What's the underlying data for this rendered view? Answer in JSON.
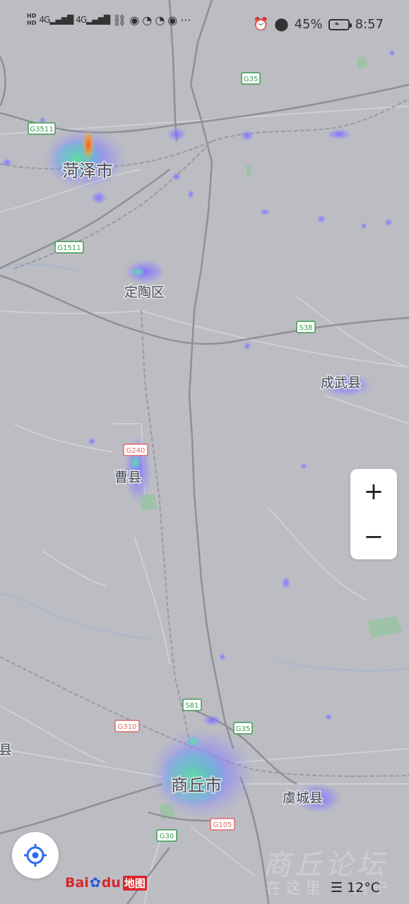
{
  "status_bar": {
    "hd_top": "HD",
    "hd_bottom": "HD",
    "net1": "4G",
    "net2": "4G",
    "battery": "45%",
    "time": "8:57",
    "more": "···"
  },
  "cities": [
    {
      "label": "菏泽市"
    },
    {
      "label": "定陶区"
    },
    {
      "label": "成武县"
    },
    {
      "label": "曹县"
    },
    {
      "label": "商丘市"
    },
    {
      "label": "虞城县"
    },
    {
      "label": "县"
    }
  ],
  "road_shields": [
    {
      "label": "G35",
      "color": "#3c9a4f"
    },
    {
      "label": "G3511",
      "color": "#3c9a4f"
    },
    {
      "label": "G1511",
      "color": "#3c9a4f"
    },
    {
      "label": "S38",
      "color": "#3c9a4f"
    },
    {
      "label": "G240",
      "color": "#e06a6a"
    },
    {
      "label": "S81",
      "color": "#3c9a4f"
    },
    {
      "label": "G35",
      "color": "#3c9a4f"
    },
    {
      "label": "G310",
      "color": "#e06a6a"
    },
    {
      "label": "G105",
      "color": "#e06a6a"
    },
    {
      "label": "G30",
      "color": "#3c9a4f"
    }
  ],
  "controls": {
    "zoom_in": "+",
    "zoom_out": "−"
  },
  "logo": {
    "bai": "Bai",
    "du": "du",
    "cn": "地图"
  },
  "weather": {
    "temp": "12°C"
  },
  "watermark": {
    "text": "商丘论坛",
    "sub": "在这里 · 商宁"
  },
  "colors": {
    "map_bg": "#bcbdc2",
    "heat_low": "#6b6cff",
    "heat_mid": "#4fe0a0",
    "heat_high": "#ff6a2a"
  }
}
